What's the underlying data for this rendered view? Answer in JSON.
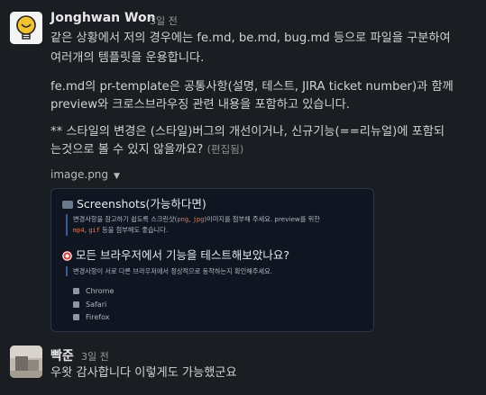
{
  "messages": [
    {
      "author": "Jonghwan Won",
      "time": "3일 전",
      "lines": [
        "같은 상황에서 저의 경우에는 fe.md, be.md, bug.md 등으로 파일을 구분하여",
        "여러개의 템플릿을 운용합니다.",
        "fe.md의 pr-template은 공통사항(설명, 테스트, JIRA ticket number)과 함께",
        "preview와 크로스브라우징 관련 내용을 포함하고 있습니다.",
        "** 스타일의 변경은 (스타일)버그의 개선이거나, 신규기능(==리뉴얼)에 포함되",
        "는것으로 볼 수 있지 않을까요?"
      ],
      "edited": "(편집됨)",
      "attachment": {
        "filename": "image.png",
        "heading1": "Screenshots(가능하다면)",
        "quote1_a": "변경사항을 참고하기 쉽도록 스크린샷(",
        "quote1_code1": "png",
        "quote1_sep": ", ",
        "quote1_code2": "jpg",
        "quote1_b": ")이미지를 첨부해 주세요. preview를 위한",
        "quote1_code3": "mp4",
        "quote1_sep2": ", ",
        "quote1_code4": "gif",
        "quote1_c": " 등을 첨부해도 좋습니다.",
        "heading2": "모든 브라우저에서 기능을 테스트해보았나요?",
        "quote2": "변경사항이 서로 다른 브라우저에서 정상적으로 동작하는지 확인해주세요.",
        "checkboxes": [
          "Chrome",
          "Safari",
          "Firefox"
        ]
      }
    },
    {
      "author": "빡준",
      "time": "3일 전",
      "lines": [
        "우왓 감사합니다 이렇게도 가능했군요"
      ]
    }
  ]
}
